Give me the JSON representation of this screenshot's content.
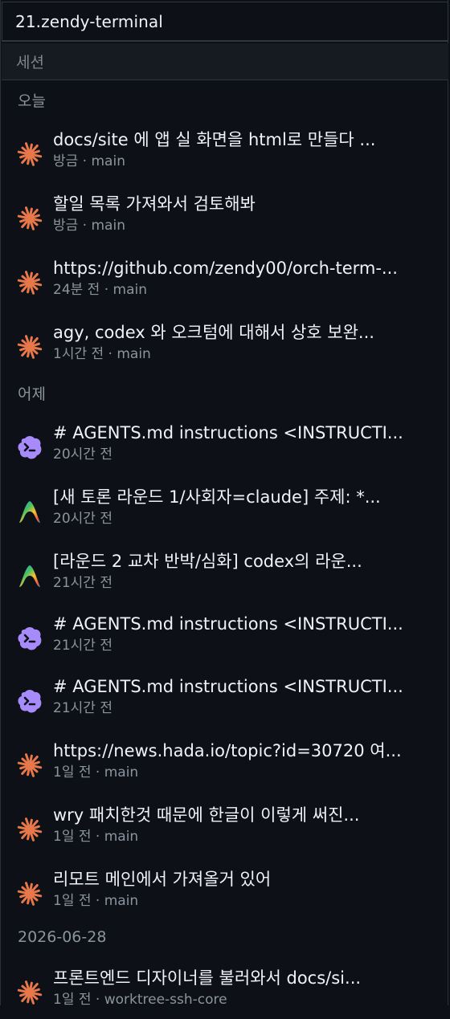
{
  "window": {
    "title": "21.zendy-terminal"
  },
  "panel": {
    "section_label": "세션"
  },
  "groups": [
    {
      "label": "오늘",
      "items": [
        {
          "icon": "claude-asterisk-icon",
          "title": "docs/site 에 앱 실 화면을 html로 만들다 ...",
          "meta": "방금 · main"
        },
        {
          "icon": "claude-asterisk-icon",
          "title": "할일 목록 가져와서 검토해봐",
          "meta": "방금 · main"
        },
        {
          "icon": "claude-asterisk-icon",
          "title": "https://github.com/zendy00/orch-term-...",
          "meta": "24분 전 · main"
        },
        {
          "icon": "claude-asterisk-icon",
          "title": "agy, codex 와 오크텀에 대해서 상호 보완...",
          "meta": "1시간 전 · main"
        }
      ]
    },
    {
      "label": "어제",
      "items": [
        {
          "icon": "codex-cloud-icon",
          "title": "# AGENTS.md instructions <INSTRUCTI...",
          "meta": "20시간 전"
        },
        {
          "icon": "gradient-a-icon",
          "title": "[새 토론 라운드 1/사회자=claude] 주제: *...",
          "meta": "20시간 전"
        },
        {
          "icon": "gradient-a-icon",
          "title": "[라운드 2 교차 반박/심화] codex의 라운...",
          "meta": "21시간 전"
        },
        {
          "icon": "codex-cloud-icon",
          "title": "# AGENTS.md instructions <INSTRUCTI...",
          "meta": "21시간 전"
        },
        {
          "icon": "codex-cloud-icon",
          "title": "# AGENTS.md instructions <INSTRUCTI...",
          "meta": "21시간 전"
        },
        {
          "icon": "claude-asterisk-icon",
          "title": "https://news.hada.io/topic?id=30720 여...",
          "meta": "1일 전 · main"
        },
        {
          "icon": "claude-asterisk-icon",
          "title": "wry 패치한것 때문에 한글이 이렇게 써진...",
          "meta": "1일 전 · main"
        },
        {
          "icon": "claude-asterisk-icon",
          "title": "리모트 메인에서 가져올거 있어",
          "meta": "1일 전 · main"
        }
      ]
    },
    {
      "label": "2026-06-28",
      "items": [
        {
          "icon": "claude-asterisk-icon",
          "title": "프론트엔드 디자이너를 불러와서 docs/si...",
          "meta": "1일 전 · worktree-ssh-core"
        }
      ]
    }
  ],
  "colors": {
    "background": "#0d1117",
    "claude_orange": "#e8784a",
    "codex_purple": "#a78bfa",
    "text_primary": "#f0f3f6",
    "text_secondary": "#8b949e"
  }
}
